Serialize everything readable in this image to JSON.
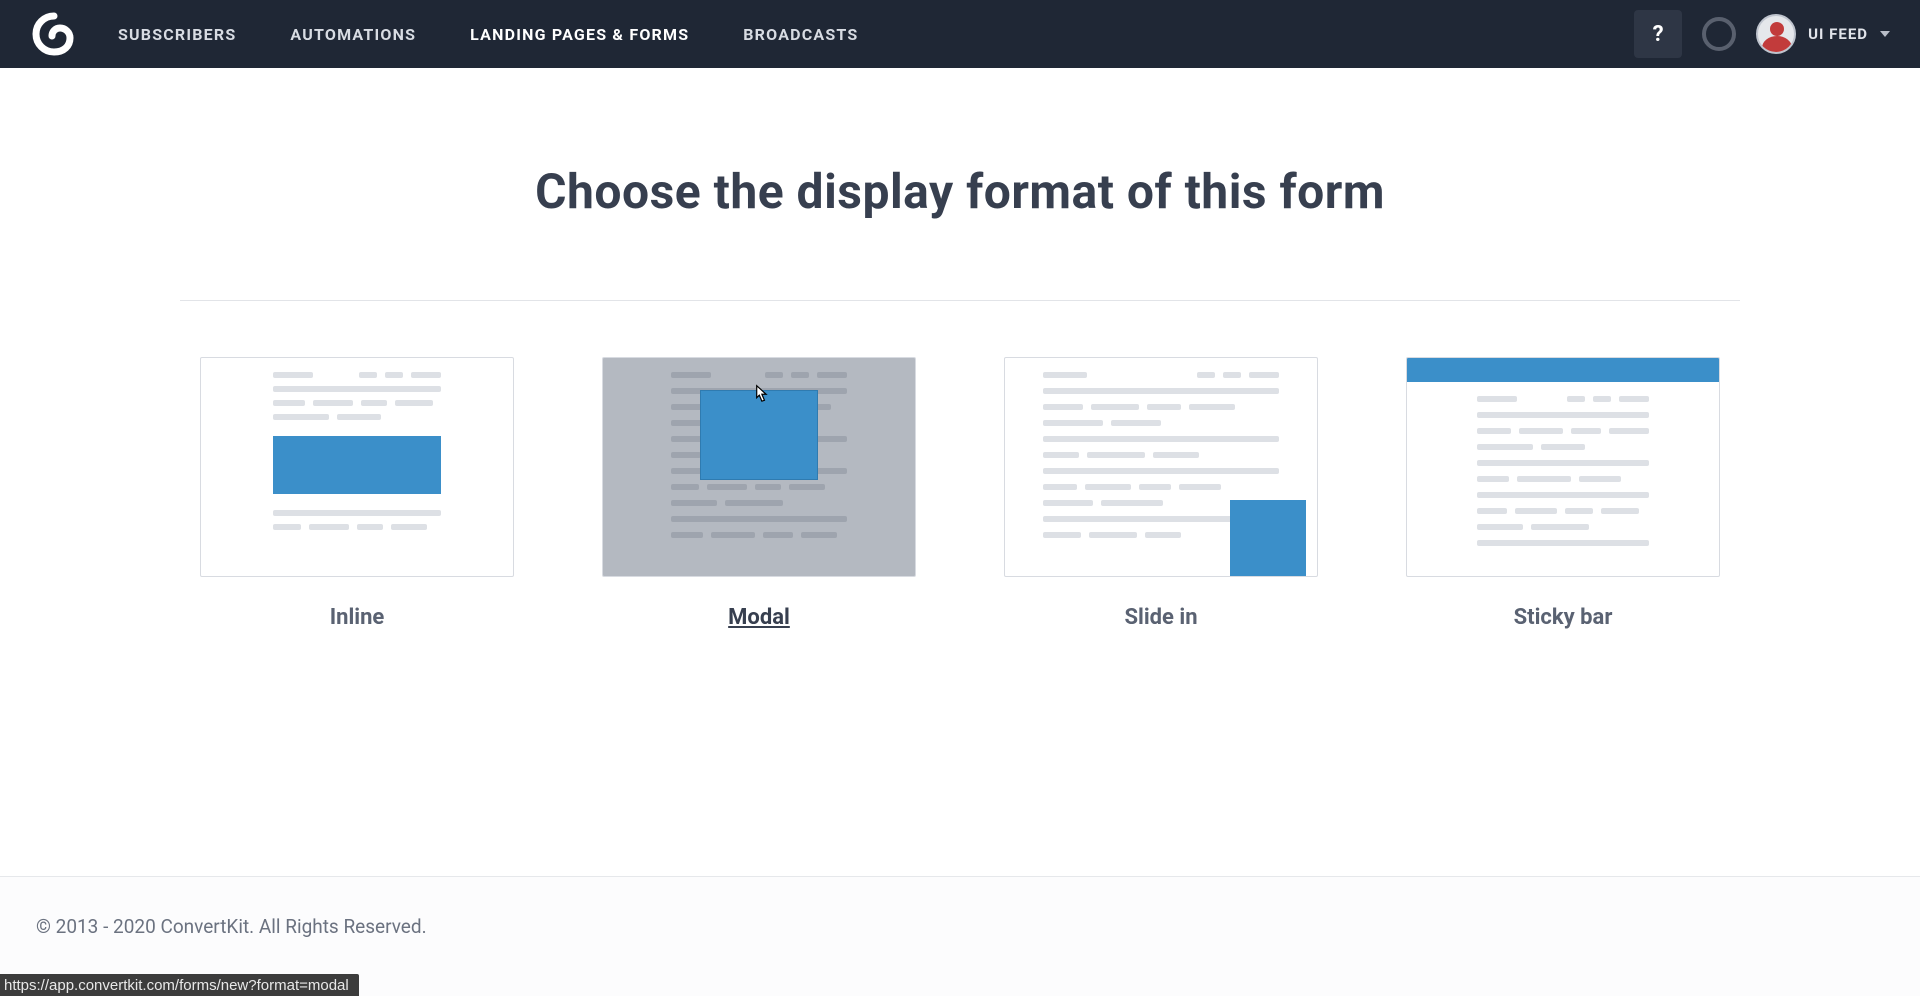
{
  "nav": {
    "items": [
      {
        "label": "SUBSCRIBERS",
        "active": false
      },
      {
        "label": "AUTOMATIONS",
        "active": false
      },
      {
        "label": "LANDING PAGES & FORMS",
        "active": true
      },
      {
        "label": "BROADCASTS",
        "active": false
      }
    ],
    "help_label": "?",
    "user_label": "UI FEED"
  },
  "page": {
    "title": "Choose the display format of this form"
  },
  "options": [
    {
      "key": "inline",
      "label": "Inline"
    },
    {
      "key": "modal",
      "label": "Modal"
    },
    {
      "key": "slidein",
      "label": "Slide in"
    },
    {
      "key": "stickybar",
      "label": "Sticky bar"
    }
  ],
  "footer": {
    "copyright": "© 2013 - 2020 ConvertKit. All Rights Reserved."
  },
  "status_url": "https://app.convertkit.com/forms/new?format=modal"
}
